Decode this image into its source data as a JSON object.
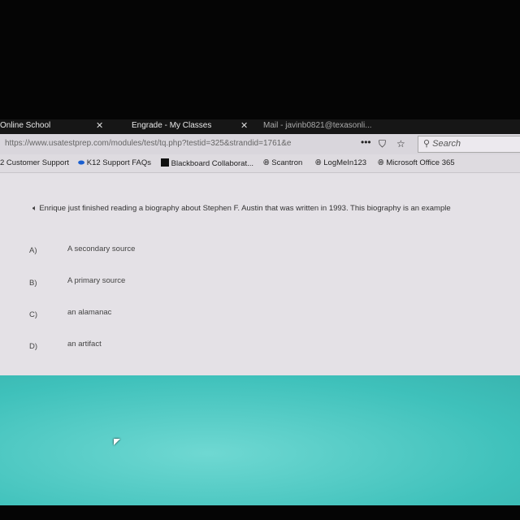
{
  "tabs": [
    {
      "label": "Online School"
    },
    {
      "label": "Engrade - My Classes"
    },
    {
      "label": "Mail - javinb0821@texasonli..."
    }
  ],
  "address_bar": {
    "url": "https://www.usatestprep.com/modules/test/tq.php?testid=325&strandid=1761&e",
    "search_placeholder": "Search"
  },
  "bookmarks": [
    {
      "label": "2 Customer Support"
    },
    {
      "label": "K12 Support FAQs"
    },
    {
      "label": "Blackboard Collaborat..."
    },
    {
      "label": "Scantron"
    },
    {
      "label": "LogMeIn123"
    },
    {
      "label": "Microsoft Office 365"
    }
  ],
  "question": {
    "text": "Enrique just finished reading a biography about Stephen F. Austin that was written in 1993. This biography is an example",
    "options": [
      {
        "letter": "A)",
        "text": "A secondary source"
      },
      {
        "letter": "B)",
        "text": "A primary source"
      },
      {
        "letter": "C)",
        "text": "an alamanac"
      },
      {
        "letter": "D)",
        "text": "an artifact"
      }
    ]
  },
  "colors": {
    "content_bg": "#e4e1e6",
    "footer_teal": "#3fc1bb"
  }
}
